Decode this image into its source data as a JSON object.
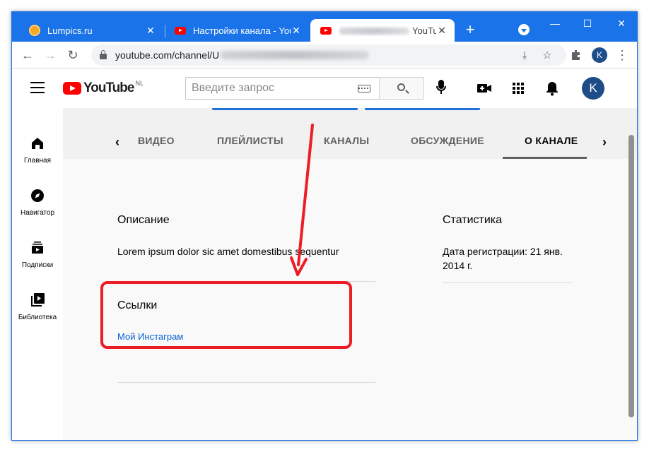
{
  "browser": {
    "tabs": [
      {
        "title": "Lumpics.ru",
        "favicon": "lumpics-favicon-icon",
        "active": false
      },
      {
        "title": "Настройки канала - YouT",
        "favicon": "youtube-favicon-icon",
        "active": false
      },
      {
        "title": "YouTu",
        "favicon": "youtube-favicon-icon",
        "active": true
      }
    ],
    "window_controls": [
      "minimize-icon",
      "maximize-icon",
      "close-icon"
    ],
    "address": {
      "url_prefix": "youtube.com/channel/U"
    },
    "profile_initial": "K"
  },
  "youtube": {
    "logo_text": "YouTube",
    "country_code": "NL",
    "search": {
      "placeholder": "Введите запрос",
      "value": ""
    },
    "avatar_initial": "K",
    "sidebar": [
      {
        "label": "Главная",
        "icon": "home-icon"
      },
      {
        "label": "Навигатор",
        "icon": "compass-icon"
      },
      {
        "label": "Подписки",
        "icon": "subscriptions-icon"
      },
      {
        "label": "Библиотека",
        "icon": "library-icon"
      }
    ],
    "channel_tabs": [
      {
        "label": "ВИДЕО",
        "selected": false
      },
      {
        "label": "ПЛЕЙЛИСТЫ",
        "selected": false
      },
      {
        "label": "КАНАЛЫ",
        "selected": false
      },
      {
        "label": "ОБСУЖДЕНИЕ",
        "selected": false
      },
      {
        "label": "О КАНАЛЕ",
        "selected": true
      }
    ],
    "about": {
      "description_title": "Описание",
      "description_text": "Lorem ipsum dolor sic amet domestibus sequentur",
      "links_title": "Ссылки",
      "link_label": "Мой Инстаграм",
      "stats_title": "Статистика",
      "registration_line1": "Дата регистрации: 21 янв.",
      "registration_line2": "2014 г."
    }
  },
  "colors": {
    "chrome_blue": "#1a73e8",
    "youtube_red": "#ff0000",
    "link_blue": "#065fd4",
    "annotation_red": "#ee1c25"
  }
}
